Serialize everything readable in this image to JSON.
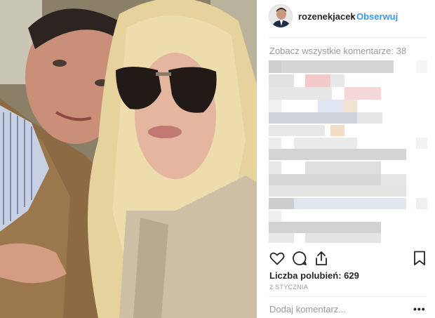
{
  "post": {
    "username": "rozenekjacek",
    "separator": "•",
    "follow_label": "Obserwuj",
    "view_all_comments": "Zobacz wszystkie komentarze: 38",
    "likes": "Liczba polubień: 629",
    "date": "2 STYCZNIA",
    "comment_placeholder": "Dodaj komentarz...",
    "more_options": "•••"
  },
  "icons": {
    "like": "heart-icon",
    "comment": "comment-icon",
    "share": "share-icon",
    "save": "bookmark-icon",
    "more": "more-options-icon"
  },
  "colors": {
    "accent": "#3897f0",
    "text": "#262626",
    "muted": "#999999",
    "divider": "#efefef"
  }
}
